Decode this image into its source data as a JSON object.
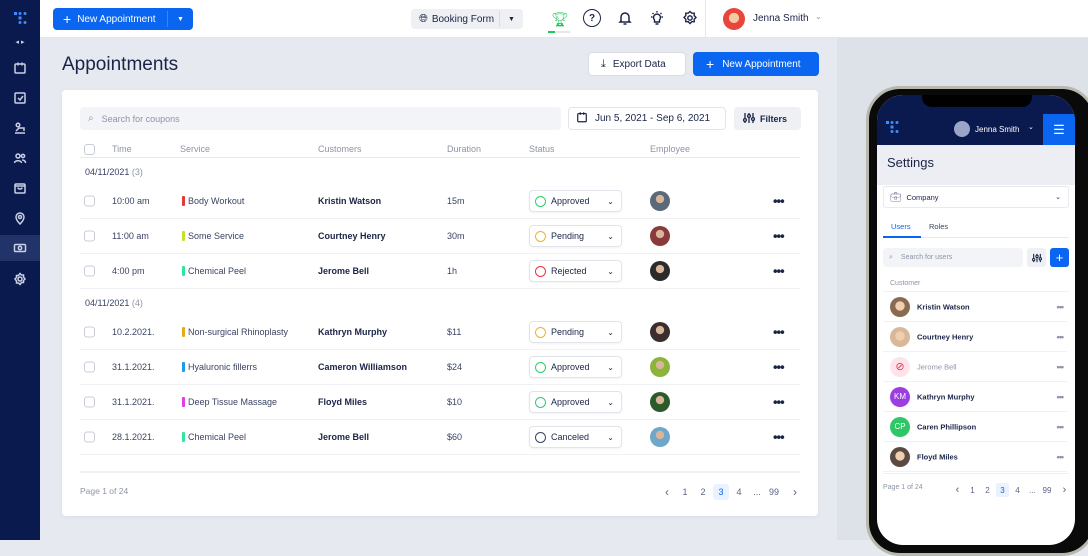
{
  "topbar": {
    "new_appointment": "New Appointment",
    "booking_form": "Booking Form",
    "user_name": "Jenna Smith"
  },
  "page": {
    "title": "Appointments",
    "export_label": "Export Data",
    "new_appointment": "New Appointment"
  },
  "filters": {
    "search_placeholder": "Search for coupons",
    "date_range": "Jun 5, 2021 - Sep 6, 2021",
    "filters_label": "Filters"
  },
  "table": {
    "headers": [
      "Time",
      "Service",
      "Customers",
      "Duration",
      "Status",
      "Employee"
    ],
    "groups": [
      {
        "date": "04/11/2021",
        "count": "(3)",
        "rows": [
          {
            "time": "10:00 am",
            "service": "Body Workout",
            "color": "#e53935",
            "customer": "Kristin Watson",
            "duration": "15m",
            "status": "Approved"
          },
          {
            "time": "11:00 am",
            "service": "Some Service",
            "color": "#c6e02c",
            "customer": "Courtney Henry",
            "duration": "30m",
            "status": "Pending"
          },
          {
            "time": "4:00 pm",
            "service": "Chemical Peel",
            "color": "#2ee6a0",
            "customer": "Jerome Bell",
            "duration": "1h",
            "status": "Rejected"
          }
        ]
      },
      {
        "date": "04/11/2021",
        "count": "(4)",
        "rows": [
          {
            "time": "10.2.2021.",
            "service": "Non-surgical Rhinoplasty",
            "color": "#e8a91a",
            "customer": "Kathryn Murphy",
            "duration": "$11",
            "status": "Pending"
          },
          {
            "time": "31.1.2021.",
            "service": "Hyaluronic fillerrs",
            "color": "#1e9be8",
            "customer": "Cameron Williamson",
            "duration": "$24",
            "status": "Approved"
          },
          {
            "time": "31.1.2021.",
            "service": "Deep Tissue Massage",
            "color": "#e43ce8",
            "customer": "Floyd Miles",
            "duration": "$10",
            "status": "Approved"
          },
          {
            "time": "28.1.2021.",
            "service": "Chemical Peel",
            "color": "#2ee6a0",
            "customer": "Jerome Bell",
            "duration": "$60",
            "status": "Canceled"
          }
        ]
      }
    ],
    "status_colors": {
      "Approved": "#2ecc71",
      "Pending": "#f5b21b",
      "Rejected": "#e8334a",
      "Canceled": "#3a4462"
    },
    "pagination": {
      "info": "Page 1 of 24",
      "pages": [
        "1",
        "2",
        "3",
        "4",
        "...",
        "99"
      ],
      "current": "3"
    }
  },
  "phone": {
    "user_name": "Jenna Smith",
    "title": "Settings",
    "company": "Company",
    "tabs": [
      "Users",
      "Roles"
    ],
    "search_placeholder": "Search for users",
    "section": "Customer",
    "users": [
      {
        "name": "Kristin Watson"
      },
      {
        "name": "Courtney Henry"
      },
      {
        "name": "Jerome Bell",
        "blocked": true
      },
      {
        "name": "Kathryn Murphy",
        "initials": "KM",
        "color": "#9b3de0"
      },
      {
        "name": "Caren Phillipson",
        "initials": "CP",
        "color": "#2ec766"
      },
      {
        "name": "Floyd Miles"
      }
    ],
    "pagination": {
      "info": "Page 1 of 24",
      "pages": [
        "1",
        "2",
        "3",
        "4",
        "...",
        "99"
      ],
      "current": "3"
    }
  }
}
